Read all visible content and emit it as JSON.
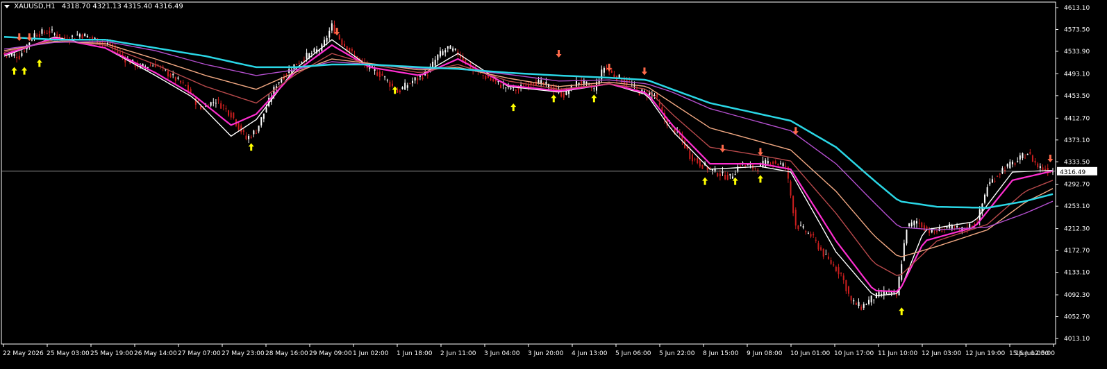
{
  "header": {
    "symbol": "XAUUSD,H1",
    "ohlc": "4318.70 4321.13 4315.40 4316.49"
  },
  "current_price_label": "4316.49",
  "colors": {
    "background": "#000000",
    "bull": "#ffffff",
    "bear": "#cc1f1f",
    "ma_fast_1": "#ffffff",
    "ma_fast_2": "#ff2ed1",
    "ma_mid_1": "#b8494b",
    "ma_mid_2": "#f2a983",
    "ma_slow_1": "#b44fcf",
    "ma_slow_2": "#2ad7e6",
    "signal_up": "#ffff00",
    "signal_down": "#ff6a4a",
    "axis": "#ffffff",
    "price_line": "#a0a0a0"
  },
  "chart_data": {
    "type": "candlestick",
    "symbol": "XAUUSD",
    "timeframe": "H1",
    "ylim": [
      4013.1,
      4613.1
    ],
    "y_ticks": [
      "4613.10",
      "4573.50",
      "4533.90",
      "4493.10",
      "4453.50",
      "4412.70",
      "4373.10",
      "4333.50",
      "4292.70",
      "4253.10",
      "4212.30",
      "4172.70",
      "4133.10",
      "4092.30",
      "4052.70",
      "4013.10"
    ],
    "x_ticks": [
      "22 May 2026",
      "25 May 03:00",
      "25 May 19:00",
      "26 May 14:00",
      "27 May 07:00",
      "27 May 23:00",
      "28 May 16:00",
      "29 May 09:00",
      "1 Jun 02:00",
      "1 Jun 18:00",
      "2 Jun 11:00",
      "3 Jun 04:00",
      "3 Jun 20:00",
      "4 Jun 13:00",
      "5 Jun 06:00",
      "5 Jun 22:00",
      "8 Jun 15:00",
      "9 Jun 08:00",
      "10 Jun 01:00",
      "10 Jun 17:00",
      "11 Jun 10:00",
      "12 Jun 03:00",
      "12 Jun 19:00",
      "15 Jun 12:00",
      "16 Jun 05:00"
    ],
    "current_price": 4316.49,
    "grid": false,
    "candle_close_path": [
      [
        0,
        4530
      ],
      [
        6,
        4525
      ],
      [
        12,
        4565
      ],
      [
        18,
        4570
      ],
      [
        24,
        4555
      ],
      [
        30,
        4565
      ],
      [
        36,
        4555
      ],
      [
        42,
        4545
      ],
      [
        48,
        4520
      ],
      [
        54,
        4505
      ],
      [
        60,
        4510
      ],
      [
        66,
        4490
      ],
      [
        72,
        4470
      ],
      [
        78,
        4430
      ],
      [
        84,
        4445
      ],
      [
        90,
        4420
      ],
      [
        96,
        4375
      ],
      [
        100,
        4390
      ],
      [
        108,
        4475
      ],
      [
        114,
        4505
      ],
      [
        120,
        4525
      ],
      [
        126,
        4540
      ],
      [
        130,
        4580
      ],
      [
        134,
        4550
      ],
      [
        140,
        4520
      ],
      [
        144,
        4505
      ],
      [
        150,
        4490
      ],
      [
        156,
        4460
      ],
      [
        162,
        4480
      ],
      [
        168,
        4495
      ],
      [
        172,
        4525
      ],
      [
        176,
        4540
      ],
      [
        180,
        4530
      ],
      [
        186,
        4500
      ],
      [
        192,
        4485
      ],
      [
        198,
        4470
      ],
      [
        204,
        4465
      ],
      [
        210,
        4480
      ],
      [
        216,
        4470
      ],
      [
        222,
        4455
      ],
      [
        228,
        4480
      ],
      [
        234,
        4465
      ],
      [
        238,
        4505
      ],
      [
        242,
        4490
      ],
      [
        248,
        4475
      ],
      [
        252,
        4460
      ],
      [
        258,
        4455
      ],
      [
        262,
        4410
      ],
      [
        268,
        4380
      ],
      [
        272,
        4345
      ],
      [
        276,
        4330
      ],
      [
        282,
        4315
      ],
      [
        288,
        4305
      ],
      [
        292,
        4330
      ],
      [
        298,
        4322
      ],
      [
        304,
        4335
      ],
      [
        310,
        4325
      ],
      [
        314,
        4220
      ],
      [
        320,
        4200
      ],
      [
        326,
        4160
      ],
      [
        332,
        4130
      ],
      [
        336,
        4080
      ],
      [
        340,
        4070
      ],
      [
        344,
        4085
      ],
      [
        350,
        4098
      ],
      [
        354,
        4090
      ],
      [
        358,
        4215
      ],
      [
        362,
        4225
      ],
      [
        368,
        4205
      ],
      [
        374,
        4215
      ],
      [
        380,
        4210
      ],
      [
        386,
        4225
      ],
      [
        390,
        4290
      ],
      [
        396,
        4320
      ],
      [
        402,
        4335
      ],
      [
        406,
        4350
      ],
      [
        410,
        4325
      ],
      [
        414,
        4318
      ],
      [
        416,
        4316.49
      ]
    ],
    "candle_count": 417,
    "moving_averages": [
      {
        "color_key": "ma_fast_1",
        "points": [
          [
            0,
            4525
          ],
          [
            20,
            4560
          ],
          [
            40,
            4540
          ],
          [
            60,
            4490
          ],
          [
            75,
            4450
          ],
          [
            90,
            4380
          ],
          [
            100,
            4410
          ],
          [
            115,
            4500
          ],
          [
            130,
            4555
          ],
          [
            145,
            4505
          ],
          [
            165,
            4490
          ],
          [
            180,
            4530
          ],
          [
            200,
            4470
          ],
          [
            220,
            4460
          ],
          [
            240,
            4475
          ],
          [
            255,
            4455
          ],
          [
            265,
            4390
          ],
          [
            280,
            4320
          ],
          [
            300,
            4325
          ],
          [
            312,
            4315
          ],
          [
            330,
            4170
          ],
          [
            345,
            4090
          ],
          [
            355,
            4095
          ],
          [
            365,
            4210
          ],
          [
            385,
            4225
          ],
          [
            400,
            4315
          ],
          [
            416,
            4318
          ]
        ]
      },
      {
        "color_key": "ma_fast_2",
        "points": [
          [
            0,
            4528
          ],
          [
            20,
            4558
          ],
          [
            40,
            4540
          ],
          [
            60,
            4495
          ],
          [
            75,
            4455
          ],
          [
            90,
            4400
          ],
          [
            100,
            4420
          ],
          [
            115,
            4495
          ],
          [
            130,
            4545
          ],
          [
            145,
            4505
          ],
          [
            165,
            4490
          ],
          [
            180,
            4520
          ],
          [
            200,
            4472
          ],
          [
            220,
            4462
          ],
          [
            240,
            4475
          ],
          [
            255,
            4458
          ],
          [
            265,
            4400
          ],
          [
            280,
            4330
          ],
          [
            300,
            4330
          ],
          [
            312,
            4320
          ],
          [
            330,
            4190
          ],
          [
            345,
            4100
          ],
          [
            355,
            4098
          ],
          [
            365,
            4190
          ],
          [
            385,
            4215
          ],
          [
            400,
            4300
          ],
          [
            416,
            4317
          ]
        ]
      },
      {
        "color_key": "ma_mid_1",
        "points": [
          [
            0,
            4532
          ],
          [
            20,
            4555
          ],
          [
            40,
            4545
          ],
          [
            60,
            4510
          ],
          [
            80,
            4470
          ],
          [
            100,
            4440
          ],
          [
            115,
            4490
          ],
          [
            130,
            4530
          ],
          [
            145,
            4510
          ],
          [
            165,
            4495
          ],
          [
            180,
            4510
          ],
          [
            200,
            4480
          ],
          [
            220,
            4465
          ],
          [
            240,
            4475
          ],
          [
            255,
            4465
          ],
          [
            265,
            4420
          ],
          [
            280,
            4360
          ],
          [
            300,
            4345
          ],
          [
            312,
            4335
          ],
          [
            330,
            4240
          ],
          [
            345,
            4150
          ],
          [
            355,
            4125
          ],
          [
            370,
            4190
          ],
          [
            390,
            4220
          ],
          [
            405,
            4280
          ],
          [
            416,
            4300
          ]
        ]
      },
      {
        "color_key": "ma_mid_2",
        "points": [
          [
            0,
            4535
          ],
          [
            20,
            4552
          ],
          [
            40,
            4548
          ],
          [
            60,
            4520
          ],
          [
            80,
            4490
          ],
          [
            100,
            4465
          ],
          [
            115,
            4495
          ],
          [
            130,
            4520
          ],
          [
            145,
            4512
          ],
          [
            165,
            4500
          ],
          [
            180,
            4505
          ],
          [
            200,
            4485
          ],
          [
            220,
            4470
          ],
          [
            240,
            4478
          ],
          [
            255,
            4470
          ],
          [
            265,
            4440
          ],
          [
            280,
            4395
          ],
          [
            300,
            4370
          ],
          [
            312,
            4355
          ],
          [
            330,
            4280
          ],
          [
            345,
            4200
          ],
          [
            355,
            4160
          ],
          [
            370,
            4180
          ],
          [
            390,
            4210
          ],
          [
            405,
            4260
          ],
          [
            416,
            4285
          ]
        ]
      },
      {
        "color_key": "ma_slow_1",
        "points": [
          [
            0,
            4538
          ],
          [
            20,
            4550
          ],
          [
            40,
            4552
          ],
          [
            60,
            4535
          ],
          [
            80,
            4510
          ],
          [
            100,
            4490
          ],
          [
            115,
            4500
          ],
          [
            130,
            4515
          ],
          [
            145,
            4510
          ],
          [
            165,
            4503
          ],
          [
            180,
            4502
          ],
          [
            200,
            4492
          ],
          [
            220,
            4480
          ],
          [
            240,
            4482
          ],
          [
            255,
            4475
          ],
          [
            265,
            4460
          ],
          [
            280,
            4430
          ],
          [
            300,
            4405
          ],
          [
            312,
            4390
          ],
          [
            330,
            4330
          ],
          [
            345,
            4260
          ],
          [
            355,
            4215
          ],
          [
            370,
            4210
          ],
          [
            390,
            4215
          ],
          [
            405,
            4240
          ],
          [
            416,
            4262
          ]
        ]
      },
      {
        "color_key": "ma_slow_2",
        "points": [
          [
            0,
            4560
          ],
          [
            20,
            4555
          ],
          [
            40,
            4555
          ],
          [
            60,
            4540
          ],
          [
            80,
            4525
          ],
          [
            100,
            4505
          ],
          [
            115,
            4505
          ],
          [
            130,
            4510
          ],
          [
            145,
            4510
          ],
          [
            165,
            4505
          ],
          [
            180,
            4502
          ],
          [
            200,
            4495
          ],
          [
            220,
            4490
          ],
          [
            240,
            4486
          ],
          [
            255,
            4482
          ],
          [
            265,
            4465
          ],
          [
            280,
            4440
          ],
          [
            300,
            4420
          ],
          [
            312,
            4408
          ],
          [
            330,
            4360
          ],
          [
            345,
            4300
          ],
          [
            355,
            4262
          ],
          [
            370,
            4252
          ],
          [
            390,
            4250
          ],
          [
            405,
            4262
          ],
          [
            416,
            4275
          ]
        ]
      }
    ],
    "signals_up": [
      [
        4,
        4518
      ],
      [
        8,
        4518
      ],
      [
        14,
        4532
      ],
      [
        98,
        4380
      ],
      [
        155,
        4483
      ],
      [
        202,
        4452
      ],
      [
        218,
        4468
      ],
      [
        234,
        4468
      ],
      [
        278,
        4318
      ],
      [
        290,
        4318
      ],
      [
        300,
        4322
      ],
      [
        356,
        4082
      ]
    ],
    "signals_down": [
      [
        6,
        4540
      ],
      [
        10,
        4540
      ],
      [
        132,
        4550
      ],
      [
        220,
        4510
      ],
      [
        240,
        4485
      ],
      [
        254,
        4478
      ],
      [
        285,
        4338
      ],
      [
        300,
        4332
      ],
      [
        314,
        4370
      ],
      [
        415,
        4320
      ]
    ]
  }
}
